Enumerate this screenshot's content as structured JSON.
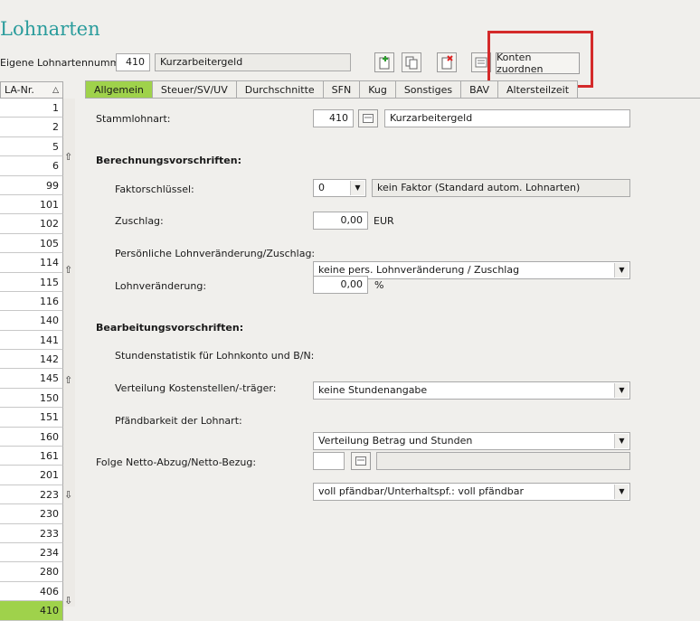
{
  "window": {
    "title": "Lohnarten"
  },
  "header": {
    "own_number_label": "Eigene Lohnartennummer:",
    "own_number_value": "410",
    "own_name_value": "Kurzarbeitergeld",
    "assign_accounts_button": "Konten zuordnen"
  },
  "list": {
    "header": "LA-Nr.",
    "items": [
      "1",
      "2",
      "5",
      "6",
      "99",
      "101",
      "102",
      "105",
      "114",
      "115",
      "116",
      "140",
      "141",
      "142",
      "145",
      "150",
      "151",
      "160",
      "161",
      "201",
      "223",
      "230",
      "233",
      "234",
      "280",
      "406",
      "410"
    ],
    "selected": "410"
  },
  "tabs": [
    {
      "label": "Allgemein",
      "active": true
    },
    {
      "label": "Steuer/SV/UV"
    },
    {
      "label": "Durchschnitte"
    },
    {
      "label": "SFN"
    },
    {
      "label": "Kug"
    },
    {
      "label": "Sonstiges"
    },
    {
      "label": "BAV"
    },
    {
      "label": "Altersteilzeit"
    }
  ],
  "form": {
    "stammlohnart_label": "Stammlohnart:",
    "stammlohnart_value": "410",
    "stammlohnart_name": "Kurzarbeitergeld",
    "section_calc": "Berechnungsvorschriften:",
    "faktor_label": "Faktorschlüssel:",
    "faktor_value": "0",
    "faktor_desc": "kein Faktor (Standard autom. Lohnarten)",
    "zuschlag_label": "Zuschlag:",
    "zuschlag_value": "0,00",
    "zuschlag_unit": "EUR",
    "pers_label": "Persönliche Lohnveränderung/Zuschlag:",
    "pers_value": "keine pers. Lohnveränderung / Zuschlag",
    "lohnv_label": "Lohnveränderung:",
    "lohnv_value": "0,00",
    "lohnv_unit": "%",
    "section_proc": "Bearbeitungsvorschriften:",
    "stunden_label": "Stundenstatistik für Lohnkonto und B/N:",
    "stunden_value": "keine Stundenangabe",
    "verteilung_label": "Verteilung Kostenstellen/-träger:",
    "verteilung_value": "Verteilung Betrag und Stunden",
    "pfand_label": "Pfändbarkeit der Lohnart:",
    "pfand_value": "voll pfändbar/Unterhaltspf.: voll pfändbar",
    "folge_label": "Folge Netto-Abzug/Netto-Bezug:",
    "folge_value": "",
    "folge_desc": ""
  }
}
